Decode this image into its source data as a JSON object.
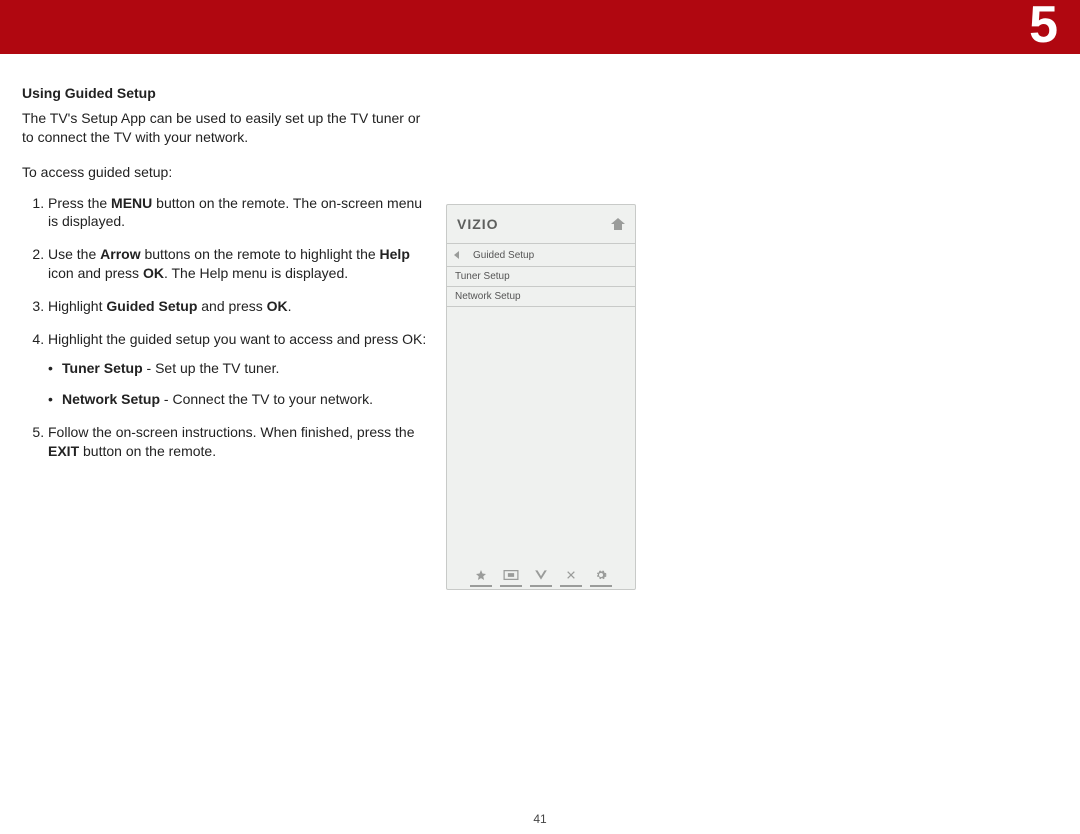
{
  "chapter_number": "5",
  "page_number": "41",
  "heading": "Using Guided Setup",
  "intro": "The TV's Setup App can be used to easily set up the TV tuner or to connect the TV with your network.",
  "lead": "To access guided setup:",
  "steps": {
    "s1a": "Press the ",
    "s1b": "MENU",
    "s1c": " button on the remote. The on-screen menu is displayed.",
    "s2a": "Use the ",
    "s2b": "Arrow",
    "s2c": " buttons on the remote to highlight the ",
    "s2d": "Help",
    "s2e": " icon and press ",
    "s2f": "OK",
    "s2g": ". The Help menu is displayed.",
    "s3a": "Highlight ",
    "s3b": "Guided Setup",
    "s3c": " and press ",
    "s3d": "OK",
    "s3e": ".",
    "s4": "Highlight the guided setup you want to access and press OK:",
    "s4_b1a": "Tuner Setup",
    "s4_b1b": " - Set up the TV tuner.",
    "s4_b2a": "Network Setup",
    "s4_b2b": " - Connect the TV to your network.",
    "s5a": "Follow the on-screen instructions. When finished, press the ",
    "s5b": "EXIT",
    "s5c": " button on the remote."
  },
  "tv": {
    "brand": "VIZIO",
    "title": "Guided Setup",
    "items": [
      "Tuner Setup",
      "Network Setup"
    ]
  }
}
